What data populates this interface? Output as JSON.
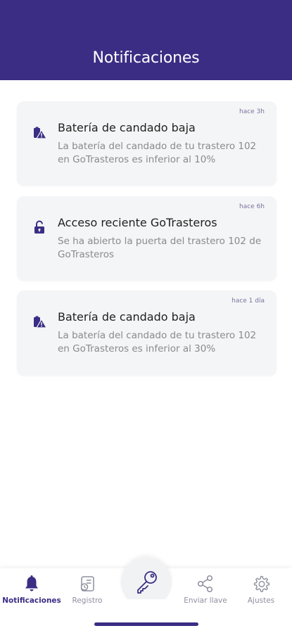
{
  "header": {
    "title": "Notificaciones"
  },
  "notifications": [
    {
      "time": "hace 3h",
      "title": "Batería de candado baja",
      "body": "La batería del candado de tu trastero 102 en GoTrasteros es inferior al 10%",
      "icon": "battery-warning-icon"
    },
    {
      "time": "hace 6h",
      "title": "Acceso reciente GoTrasteros",
      "body": "Se ha abierto la puerta del trastero 102 de GoTrasteros",
      "icon": "unlocked-padlock-icon"
    },
    {
      "time": "hace 1 día",
      "title": "Batería de candado baja",
      "body": "La batería del candado de tu trastero 102 en GoTrasteros es inferior al 30%",
      "icon": "battery-warning-icon"
    }
  ],
  "nav": {
    "items": [
      {
        "label": "Notificaciones",
        "icon": "bell-icon",
        "active": true
      },
      {
        "label": "Registro",
        "icon": "history-icon",
        "active": false
      },
      {
        "label": "Enviar llave",
        "icon": "share-icon",
        "active": false
      },
      {
        "label": "Ajustes",
        "icon": "gear-icon",
        "active": false
      }
    ],
    "center_icon": "key-icon"
  },
  "colors": {
    "primary": "#3b2d84",
    "card_bg": "#f4f5f6",
    "muted_text": "#8a8a8a"
  }
}
